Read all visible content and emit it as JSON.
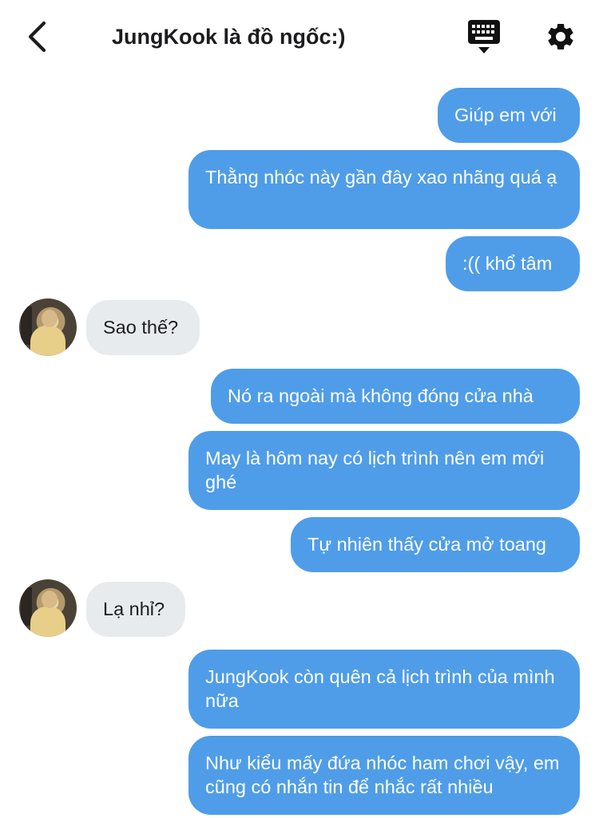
{
  "header": {
    "title": "JungKook là đồ ngốc:)",
    "back_icon": "chevron-left-icon",
    "keyboard_icon": "keyboard-icon",
    "settings_icon": "gear-icon"
  },
  "colors": {
    "outgoing_bubble": "#4f9de8",
    "incoming_bubble": "#e8ebee"
  },
  "messages": [
    {
      "side": "out",
      "text": "Giúp em với"
    },
    {
      "side": "out",
      "text": "Thằng nhóc này gần đây xao nhãng quá ạ"
    },
    {
      "side": "out",
      "text": ":(( khổ tâm"
    },
    {
      "side": "in",
      "text": "Sao thế?"
    },
    {
      "side": "out",
      "text": "Nó ra ngoài mà không đóng cửa nhà"
    },
    {
      "side": "out",
      "text": "May là hôm nay có lịch trình nên em mới ghé"
    },
    {
      "side": "out",
      "text": "Tự nhiên thấy cửa mở toang"
    },
    {
      "side": "in",
      "text": "Lạ nhỉ?"
    },
    {
      "side": "out",
      "text": "JungKook còn quên cả lịch trình của mình nữa"
    },
    {
      "side": "out",
      "text": "Như kiểu mấy đứa nhóc ham chơi vậy, em cũng có nhắn tin để nhắc rất nhiều"
    }
  ]
}
